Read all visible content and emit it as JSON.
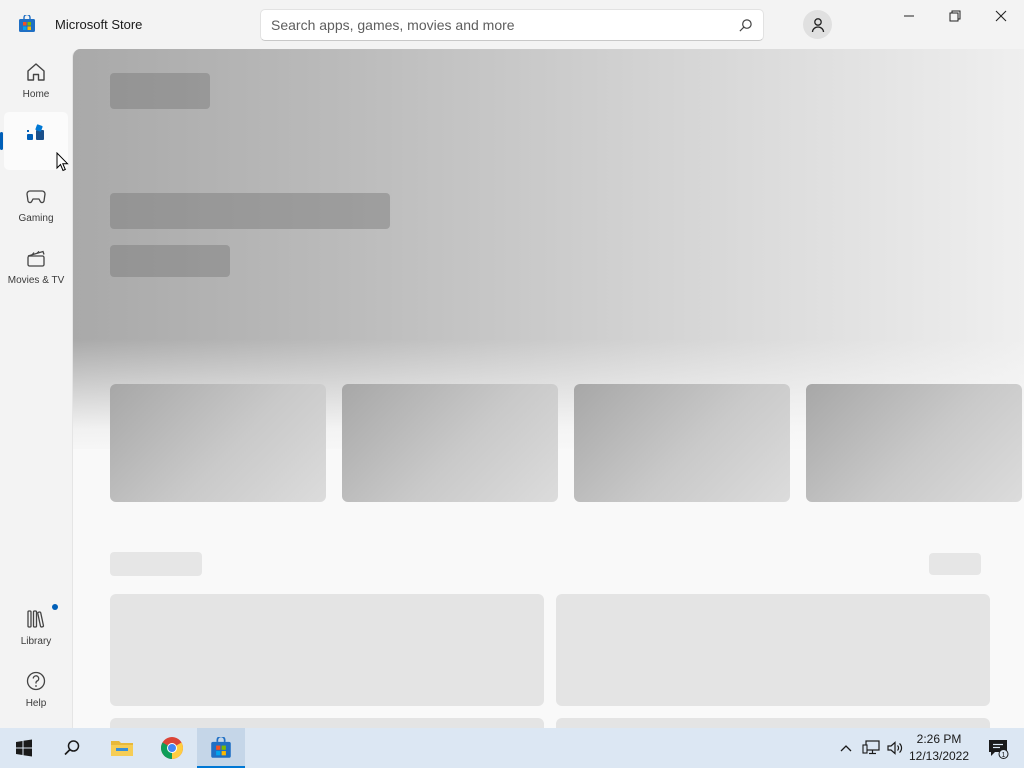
{
  "app": {
    "title": "Microsoft Store"
  },
  "search": {
    "placeholder": "Search apps, games, movies and more",
    "value": ""
  },
  "sidebar": {
    "items": [
      {
        "label": "Home",
        "icon": "home-icon"
      },
      {
        "label": "",
        "icon": "apps-icon",
        "active": true
      },
      {
        "label": "Gaming",
        "icon": "gamepad-icon"
      },
      {
        "label": "Movies & TV",
        "icon": "clapperboard-icon"
      }
    ],
    "bottom_items": [
      {
        "label": "Library",
        "icon": "library-icon",
        "badge": true
      },
      {
        "label": "Help",
        "icon": "help-icon"
      }
    ]
  },
  "main": {
    "loading": true
  },
  "taskbar": {
    "apps": [
      "start-icon",
      "search-icon",
      "file-explorer-icon",
      "chrome-icon",
      "microsoft-store-icon"
    ],
    "clock": {
      "time": "2:26 PM",
      "date": "12/13/2022"
    },
    "notifications": "1"
  },
  "colors": {
    "accent": "#005fb8",
    "taskbar": "#dce7f3"
  }
}
